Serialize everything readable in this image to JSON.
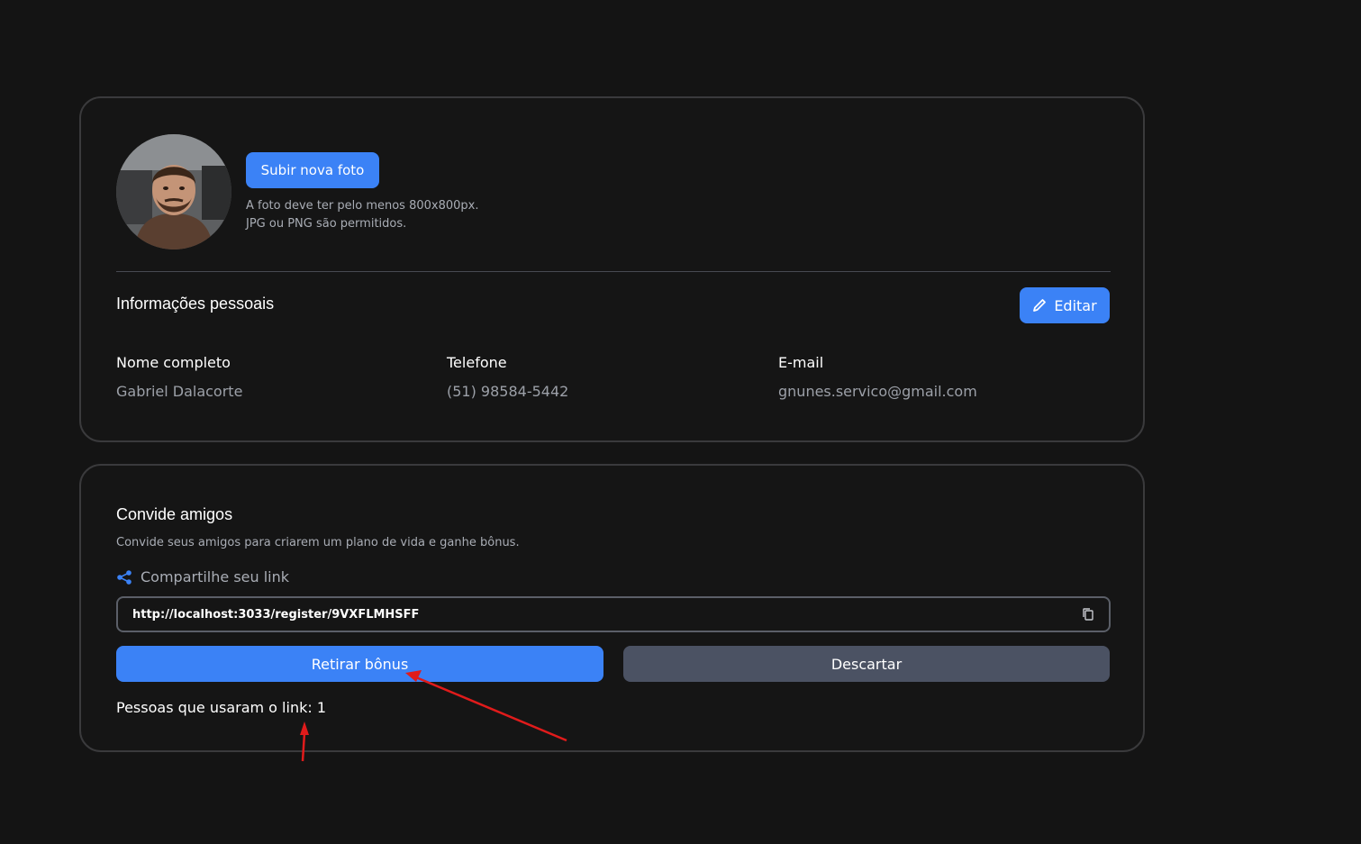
{
  "profile": {
    "avatar_icon": "user-avatar-photo",
    "upload_button": "Subir nova foto",
    "photo_hint_line1": "A foto deve ter pelo menos 800x800px.",
    "photo_hint_line2": "JPG ou PNG são permitidos.",
    "personal_title": "Informações pessoais",
    "edit_button": "Editar",
    "edit_icon": "pencil-icon",
    "fields": [
      {
        "label": "Nome completo",
        "value": "Gabriel Dalacorte"
      },
      {
        "label": "Telefone",
        "value": "(51) 98584-5442"
      },
      {
        "label": "E-mail",
        "value": "gnunes.servico@gmail.com"
      }
    ]
  },
  "invite": {
    "title": "Convide amigos",
    "description": "Convide seus amigos para criarem um plano de vida e ganhe bônus.",
    "share_label": "Compartilhe seu link",
    "share_icon": "share-icon",
    "link": "http://localhost:3033/register/9VXFLMHSFF",
    "copy_icon": "copy-icon",
    "withdraw_button": "Retirar bônus",
    "discard_button": "Descartar",
    "usage_text": "Pessoas que usaram o link: 1"
  },
  "colors": {
    "background": "#141414",
    "primary": "#3b82f6",
    "secondary_button": "#4b5263",
    "annotation_arrow": "#e01b1b"
  }
}
